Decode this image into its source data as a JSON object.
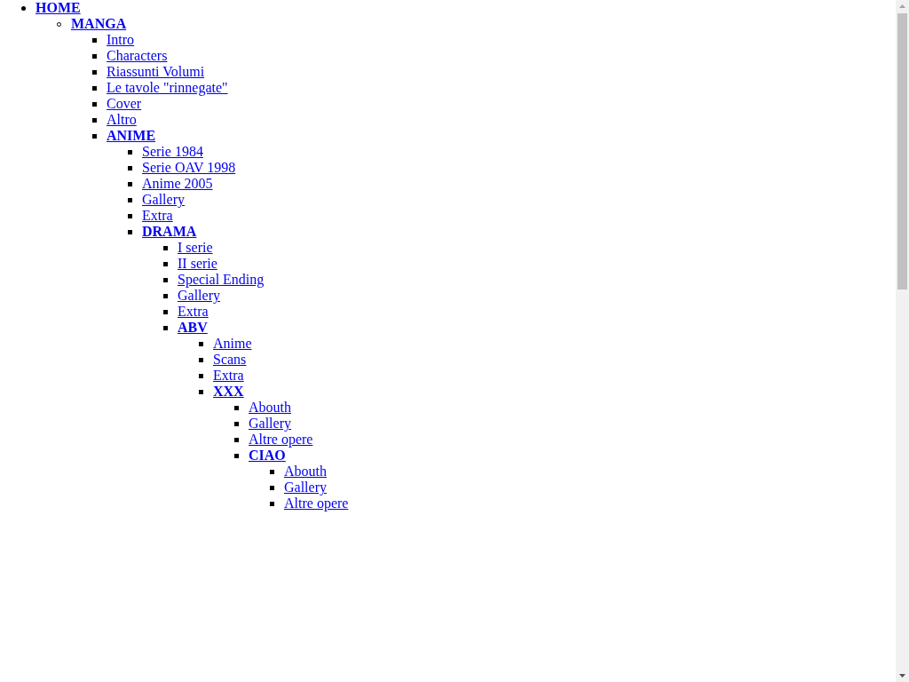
{
  "menu": {
    "items": [
      {
        "label": "HOME",
        "children": [
          {
            "label": "MANGA",
            "children": [
              {
                "label": "Intro"
              },
              {
                "label": "Characters"
              },
              {
                "label": "Riassunti Volumi"
              },
              {
                "label": "Le tavole \"rinnegate\""
              },
              {
                "label": "Cover"
              },
              {
                "label": "Altro"
              },
              {
                "label": "ANIME",
                "children": [
                  {
                    "label": "Serie 1984"
                  },
                  {
                    "label": "Serie OAV 1998"
                  },
                  {
                    "label": "Anime 2005"
                  },
                  {
                    "label": "Gallery"
                  },
                  {
                    "label": "Extra"
                  },
                  {
                    "label": "DRAMA",
                    "children": [
                      {
                        "label": "I serie"
                      },
                      {
                        "label": "II serie"
                      },
                      {
                        "label": "Special Ending"
                      },
                      {
                        "label": "Gallery"
                      },
                      {
                        "label": "Extra"
                      },
                      {
                        "label": "ABV",
                        "children": [
                          {
                            "label": "Anime"
                          },
                          {
                            "label": "Scans"
                          },
                          {
                            "label": "Extra"
                          },
                          {
                            "label": "XXX",
                            "children": [
                              {
                                "label": "Abouth"
                              },
                              {
                                "label": "Gallery"
                              },
                              {
                                "label": "Altre opere"
                              },
                              {
                                "label": "CIAO",
                                "children": [
                                  {
                                    "label": "Abouth"
                                  },
                                  {
                                    "label": "Gallery"
                                  },
                                  {
                                    "label": "Altre opere"
                                  }
                                ]
                              }
                            ]
                          }
                        ]
                      }
                    ]
                  }
                ]
              }
            ]
          }
        ]
      }
    ]
  }
}
